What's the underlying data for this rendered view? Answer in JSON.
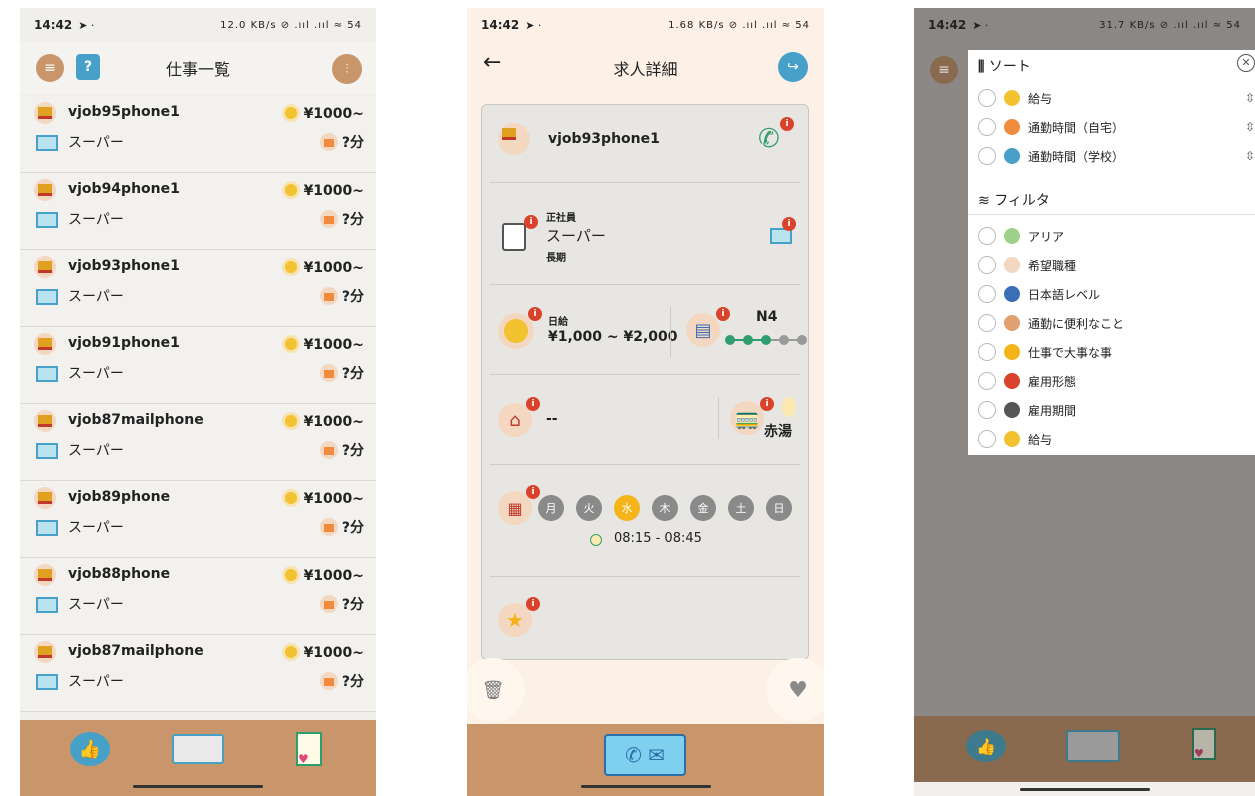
{
  "status_bar": {
    "time": "14:42",
    "p1_icons": "12.0 KB/s ⊘ .ııl .ııl ≈ 54",
    "p2_icons": "1.68 KB/s ⊘ .ııl .ııl ≈ 54",
    "p3_icons": "31.7 KB/s ⊘ .ııl .ııl ≈ 54"
  },
  "job_list": {
    "title": "仕事一覧",
    "items": [
      {
        "name": "vjob95phone1",
        "category": "スーパー",
        "salary": "¥1000~",
        "time": "?分"
      },
      {
        "name": "vjob94phone1",
        "category": "スーパー",
        "salary": "¥1000~",
        "time": "?分"
      },
      {
        "name": "vjob93phone1",
        "category": "スーパー",
        "salary": "¥1000~",
        "time": "?分"
      },
      {
        "name": "vjob91phone1",
        "category": "スーパー",
        "salary": "¥1000~",
        "time": "?分"
      },
      {
        "name": "vjob87mailphone",
        "category": "スーパー",
        "salary": "¥1000~",
        "time": "?分"
      },
      {
        "name": "vjob89phone",
        "category": "スーパー",
        "salary": "¥1000~",
        "time": "?分"
      },
      {
        "name": "vjob88phone",
        "category": "スーパー",
        "salary": "¥1000~",
        "time": "?分"
      },
      {
        "name": "vjob87mailphone",
        "category": "スーパー",
        "salary": "¥1000~",
        "time": "?分"
      }
    ]
  },
  "job_detail": {
    "title": "求人詳細",
    "company": "vjob93phone1",
    "employment_type": "正社員",
    "category": "スーパー",
    "period": "長期",
    "pay_unit": "日給",
    "pay_range": "¥1,000 ~ ¥2,000",
    "japanese_level": "N4",
    "japanese_level_index": 2,
    "commute": "--",
    "station": "赤湯",
    "days": [
      {
        "label": "月",
        "active": false
      },
      {
        "label": "火",
        "active": false
      },
      {
        "label": "水",
        "active": true
      },
      {
        "label": "木",
        "active": false
      },
      {
        "label": "金",
        "active": false
      },
      {
        "label": "土",
        "active": false
      },
      {
        "label": "日",
        "active": false
      }
    ],
    "hours": "08:15 - 08:45"
  },
  "sort_filter": {
    "sort_title": "ソート",
    "sort_items": [
      "給与",
      "通勤時間（自宅）",
      "通勤時間（学校）"
    ],
    "filter_title": "フィルタ",
    "filter_items": [
      "アリア",
      "希望職種",
      "日本語レベル",
      "通勤に便利なこと",
      "仕事で大事な事",
      "雇用形態",
      "雇用期間",
      "給与"
    ]
  },
  "colors": {
    "bottom_nav": "#c8966a",
    "accent_yellow": "#f4b41a",
    "badge_red": "#d9432b"
  }
}
